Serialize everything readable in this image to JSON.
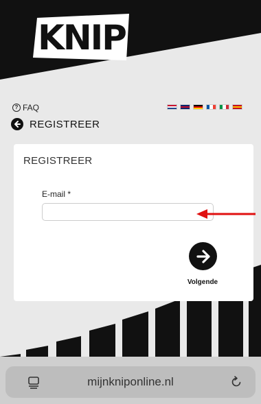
{
  "header": {
    "logo_text": "KNIP"
  },
  "topbar": {
    "faq_icon": "?",
    "faq_label": "FAQ",
    "languages": [
      {
        "code": "nl",
        "stripes": [
          "#c8102e",
          "#ffffff",
          "#21468b"
        ],
        "dir": "h"
      },
      {
        "code": "en",
        "stripes": [
          "#012169",
          "#c8102e",
          "#012169"
        ],
        "dir": "h"
      },
      {
        "code": "de",
        "stripes": [
          "#000000",
          "#dd0000",
          "#ffce00"
        ],
        "dir": "h"
      },
      {
        "code": "fr",
        "stripes": [
          "#0055a4",
          "#ffffff",
          "#ef4135"
        ],
        "dir": "v"
      },
      {
        "code": "it",
        "stripes": [
          "#009246",
          "#ffffff",
          "#ce2b37"
        ],
        "dir": "v"
      },
      {
        "code": "es",
        "stripes": [
          "#c60b1e",
          "#ffc400",
          "#c60b1e"
        ],
        "dir": "h"
      }
    ]
  },
  "nav": {
    "back_label": "REGISTREER"
  },
  "card": {
    "title": "REGISTREER",
    "email_label": "E-mail *",
    "email_value": "",
    "email_placeholder": "",
    "next_label": "Volgende"
  },
  "browser": {
    "url": "mijnkniponline.nl"
  },
  "colors": {
    "dark": "#111111",
    "background": "#e9e9e9",
    "annotation": "#e01010"
  }
}
